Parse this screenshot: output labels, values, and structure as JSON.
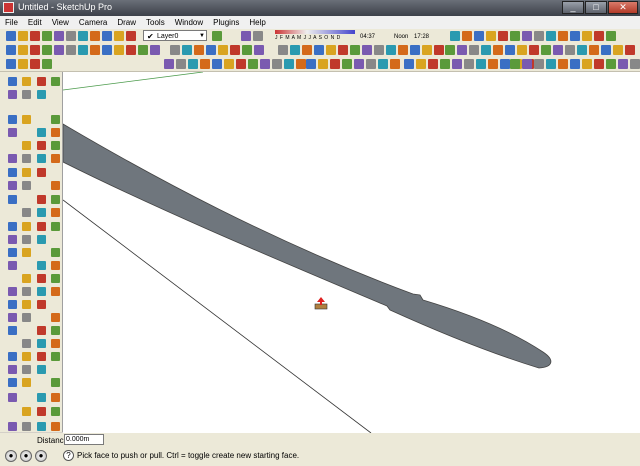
{
  "window": {
    "title": "Untitled - SketchUp Pro",
    "minimize": "_",
    "maximize": "□",
    "close": "✕"
  },
  "menu": [
    "File",
    "Edit",
    "View",
    "Camera",
    "Draw",
    "Tools",
    "Window",
    "Plugins",
    "Help"
  ],
  "toolbar": {
    "layer": "Layer0",
    "shadow_months": "J F M A M J J A S O N D",
    "shadow_time": "04:37",
    "noon_label": "Noon",
    "end_time": "17:28"
  },
  "vcb": {
    "label": "Distance",
    "value": "0.000m"
  },
  "status": {
    "message": "Pick face to push or pull.  Ctrl = toggle create new starting face."
  },
  "icons": [
    "toolbar-icons",
    "select-icon",
    "eraser-icon",
    "paint-bucket-icon",
    "pushpull-cursor-icon"
  ]
}
